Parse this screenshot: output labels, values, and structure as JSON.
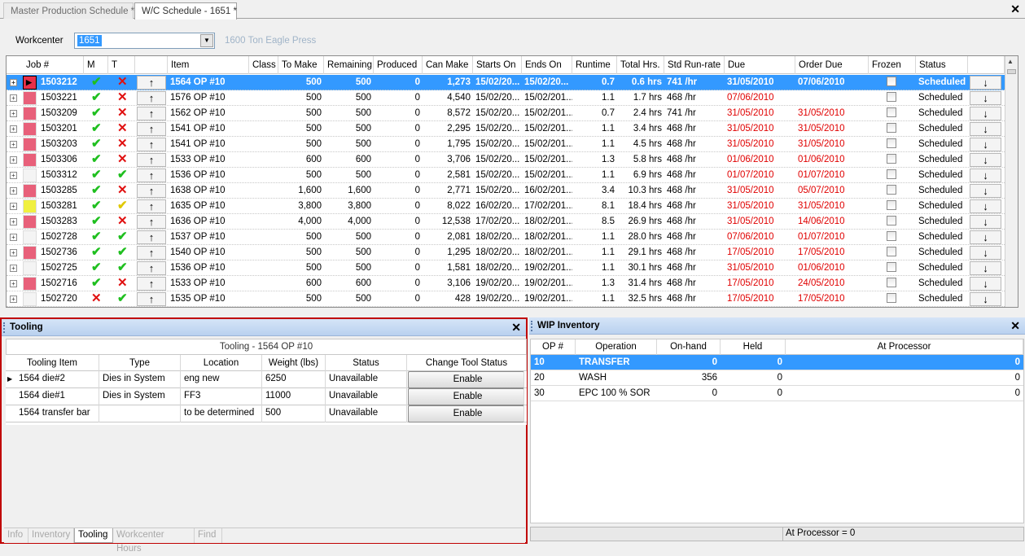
{
  "tabs": [
    "Master Production Schedule *",
    "W/C Schedule - 1651 *"
  ],
  "workcenter": {
    "label": "Workcenter",
    "value": "1651",
    "description": "1600 Ton Eagle Press"
  },
  "grid": {
    "headers": [
      "Job #",
      "M",
      "T",
      "",
      "Item",
      "Class",
      "To Make",
      "Remaining",
      "Produced",
      "Can Make",
      "Starts On",
      "Ends On",
      "Runtime",
      "Total Hrs.",
      "Std Run-rate",
      "Due",
      "Order Due",
      "Frozen",
      "Status",
      ""
    ],
    "rows": [
      {
        "job": "1503212",
        "swatch": "#e8304a",
        "m": "check",
        "t": "cross",
        "item": "1564 OP #10",
        "to_make": "500",
        "remaining": "500",
        "produced": "0",
        "can_make": "1,273",
        "starts": "15/02/20...",
        "ends": "15/02/20...",
        "runtime": "0.7",
        "total": "0.6 hrs",
        "rate": "741 /hr",
        "due": "31/05/2010",
        "due_red": false,
        "order_due": "07/06/2010",
        "order_red": false,
        "status": "Scheduled",
        "sel": true
      },
      {
        "job": "1503221",
        "swatch": "#e8607a",
        "m": "check",
        "t": "cross",
        "item": "1576 OP #10",
        "to_make": "500",
        "remaining": "500",
        "produced": "0",
        "can_make": "4,540",
        "starts": "15/02/20...",
        "ends": "15/02/201...",
        "runtime": "1.1",
        "total": "1.7 hrs",
        "rate": "468 /hr",
        "due": "07/06/2010",
        "due_red": true,
        "order_due": "",
        "order_red": true,
        "status": "Scheduled",
        "sel": false
      },
      {
        "job": "1503209",
        "swatch": "#e8607a",
        "m": "check",
        "t": "cross",
        "item": "1562 OP #10",
        "to_make": "500",
        "remaining": "500",
        "produced": "0",
        "can_make": "8,572",
        "starts": "15/02/20...",
        "ends": "15/02/201...",
        "runtime": "0.7",
        "total": "2.4 hrs",
        "rate": "741 /hr",
        "due": "31/05/2010",
        "due_red": true,
        "order_due": "31/05/2010",
        "order_red": true,
        "status": "Scheduled",
        "sel": false
      },
      {
        "job": "1503201",
        "swatch": "#e8607a",
        "m": "check",
        "t": "cross",
        "item": "1541 OP #10",
        "to_make": "500",
        "remaining": "500",
        "produced": "0",
        "can_make": "2,295",
        "starts": "15/02/20...",
        "ends": "15/02/201...",
        "runtime": "1.1",
        "total": "3.4 hrs",
        "rate": "468 /hr",
        "due": "31/05/2010",
        "due_red": true,
        "order_due": "31/05/2010",
        "order_red": true,
        "status": "Scheduled",
        "sel": false
      },
      {
        "job": "1503203",
        "swatch": "#e8607a",
        "m": "check",
        "t": "cross",
        "item": "1541 OP #10",
        "to_make": "500",
        "remaining": "500",
        "produced": "0",
        "can_make": "1,795",
        "starts": "15/02/20...",
        "ends": "15/02/201...",
        "runtime": "1.1",
        "total": "4.5 hrs",
        "rate": "468 /hr",
        "due": "31/05/2010",
        "due_red": true,
        "order_due": "31/05/2010",
        "order_red": true,
        "status": "Scheduled",
        "sel": false
      },
      {
        "job": "1503306",
        "swatch": "#e8607a",
        "m": "check",
        "t": "cross",
        "item": "1533 OP #10",
        "to_make": "600",
        "remaining": "600",
        "produced": "0",
        "can_make": "3,706",
        "starts": "15/02/20...",
        "ends": "15/02/201...",
        "runtime": "1.3",
        "total": "5.8 hrs",
        "rate": "468 /hr",
        "due": "01/06/2010",
        "due_red": true,
        "order_due": "01/06/2010",
        "order_red": true,
        "status": "Scheduled",
        "sel": false
      },
      {
        "job": "1503312",
        "swatch": "#f4f4f4",
        "m": "check",
        "t": "check",
        "item": "1536 OP #10",
        "to_make": "500",
        "remaining": "500",
        "produced": "0",
        "can_make": "2,581",
        "starts": "15/02/20...",
        "ends": "15/02/201...",
        "runtime": "1.1",
        "total": "6.9 hrs",
        "rate": "468 /hr",
        "due": "01/07/2010",
        "due_red": true,
        "order_due": "01/07/2010",
        "order_red": true,
        "status": "Scheduled",
        "sel": false
      },
      {
        "job": "1503285",
        "swatch": "#e8607a",
        "m": "check",
        "t": "cross",
        "item": "1638 OP #10",
        "to_make": "1,600",
        "remaining": "1,600",
        "produced": "0",
        "can_make": "2,771",
        "starts": "15/02/20...",
        "ends": "16/02/201...",
        "runtime": "3.4",
        "total": "10.3 hrs",
        "rate": "468 /hr",
        "due": "31/05/2010",
        "due_red": true,
        "order_due": "05/07/2010",
        "order_red": true,
        "status": "Scheduled",
        "sel": false
      },
      {
        "job": "1503281",
        "swatch": "#f0f040",
        "m": "check",
        "t": "yellow",
        "item": "1635 OP #10",
        "to_make": "3,800",
        "remaining": "3,800",
        "produced": "0",
        "can_make": "8,022",
        "starts": "16/02/20...",
        "ends": "17/02/201...",
        "runtime": "8.1",
        "total": "18.4 hrs",
        "rate": "468 /hr",
        "due": "31/05/2010",
        "due_red": true,
        "order_due": "31/05/2010",
        "order_red": true,
        "status": "Scheduled",
        "sel": false
      },
      {
        "job": "1503283",
        "swatch": "#e8607a",
        "m": "check",
        "t": "cross",
        "item": "1636 OP #10",
        "to_make": "4,000",
        "remaining": "4,000",
        "produced": "0",
        "can_make": "12,538",
        "starts": "17/02/20...",
        "ends": "18/02/201...",
        "runtime": "8.5",
        "total": "26.9 hrs",
        "rate": "468 /hr",
        "due": "31/05/2010",
        "due_red": true,
        "order_due": "14/06/2010",
        "order_red": true,
        "status": "Scheduled",
        "sel": false
      },
      {
        "job": "1502728",
        "swatch": "#f4f4f4",
        "m": "check",
        "t": "check",
        "item": "1537 OP #10",
        "to_make": "500",
        "remaining": "500",
        "produced": "0",
        "can_make": "2,081",
        "starts": "18/02/20...",
        "ends": "18/02/201...",
        "runtime": "1.1",
        "total": "28.0 hrs",
        "rate": "468 /hr",
        "due": "07/06/2010",
        "due_red": true,
        "order_due": "01/07/2010",
        "order_red": true,
        "status": "Scheduled",
        "sel": false
      },
      {
        "job": "1502736",
        "swatch": "#e8607a",
        "m": "check",
        "t": "check",
        "item": "1540 OP #10",
        "to_make": "500",
        "remaining": "500",
        "produced": "0",
        "can_make": "1,295",
        "starts": "18/02/20...",
        "ends": "18/02/201...",
        "runtime": "1.1",
        "total": "29.1 hrs",
        "rate": "468 /hr",
        "due": "17/05/2010",
        "due_red": true,
        "order_due": "17/05/2010",
        "order_red": true,
        "status": "Scheduled",
        "sel": false
      },
      {
        "job": "1502725",
        "swatch": "#f4f4f4",
        "m": "check",
        "t": "check",
        "item": "1536 OP #10",
        "to_make": "500",
        "remaining": "500",
        "produced": "0",
        "can_make": "1,581",
        "starts": "18/02/20...",
        "ends": "19/02/201...",
        "runtime": "1.1",
        "total": "30.1 hrs",
        "rate": "468 /hr",
        "due": "31/05/2010",
        "due_red": true,
        "order_due": "01/06/2010",
        "order_red": true,
        "status": "Scheduled",
        "sel": false
      },
      {
        "job": "1502716",
        "swatch": "#e8607a",
        "m": "check",
        "t": "cross",
        "item": "1533 OP #10",
        "to_make": "600",
        "remaining": "600",
        "produced": "0",
        "can_make": "3,106",
        "starts": "19/02/20...",
        "ends": "19/02/201...",
        "runtime": "1.3",
        "total": "31.4 hrs",
        "rate": "468 /hr",
        "due": "17/05/2010",
        "due_red": true,
        "order_due": "24/05/2010",
        "order_red": true,
        "status": "Scheduled",
        "sel": false
      },
      {
        "job": "1502720",
        "swatch": "#f4f4f4",
        "m": "cross",
        "t": "check",
        "item": "1535 OP #10",
        "to_make": "500",
        "remaining": "500",
        "produced": "0",
        "can_make": "428",
        "starts": "19/02/20...",
        "ends": "19/02/201...",
        "runtime": "1.1",
        "total": "32.5 hrs",
        "rate": "468 /hr",
        "due": "17/05/2010",
        "due_red": true,
        "order_due": "17/05/2010",
        "order_red": true,
        "status": "Scheduled",
        "sel": false
      }
    ]
  },
  "tooling": {
    "title": "Tooling",
    "subtitle": "Tooling - 1564 OP #10",
    "headers": [
      "Tooling Item",
      "Type",
      "Location",
      "Weight (lbs)",
      "Status",
      "Change Tool Status"
    ],
    "rows": [
      {
        "item": "1564 die#2",
        "type": "Dies in System",
        "location": "eng new",
        "weight": "6250",
        "status": "Unavailable",
        "action": "Enable"
      },
      {
        "item": "1564 die#1",
        "type": "Dies in System",
        "location": "FF3",
        "weight": "11000",
        "status": "Unavailable",
        "action": "Enable"
      },
      {
        "item": "1564 transfer bar",
        "type": "",
        "location": "to be determined",
        "weight": "500",
        "status": "Unavailable",
        "action": "Enable"
      }
    ],
    "bottom_tabs": [
      "Info",
      "Inventory",
      "Tooling",
      "Workcenter Hours",
      "Find"
    ]
  },
  "wip": {
    "title": "WIP Inventory",
    "headers": [
      "OP #",
      "Operation",
      "On-hand",
      "Held",
      "At Processor"
    ],
    "rows": [
      {
        "op": "10",
        "operation": "TRANSFER",
        "onhand": "0",
        "held": "0",
        "atproc": "0",
        "sel": true
      },
      {
        "op": "20",
        "operation": "WASH",
        "onhand": "356",
        "held": "0",
        "atproc": "0",
        "sel": false
      },
      {
        "op": "30",
        "operation": "EPC 100 % SOR",
        "onhand": "0",
        "held": "0",
        "atproc": "0",
        "sel": false
      }
    ],
    "footer": "At Processor = 0"
  },
  "colors": {
    "selection": "#3399ff",
    "panel_highlight": "#c00000",
    "late_date": "#e00000"
  }
}
